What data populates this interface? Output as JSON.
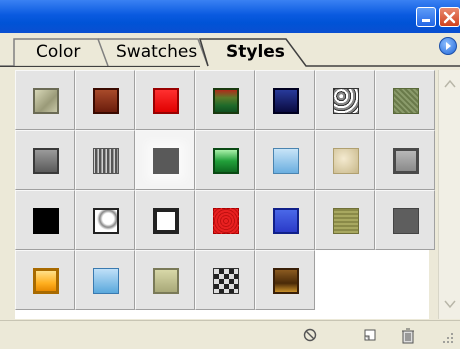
{
  "tabs": [
    {
      "label": "Color"
    },
    {
      "label": "Swatches"
    },
    {
      "label": "Styles"
    }
  ],
  "colors": {
    "titlebar": "#0a5ae0",
    "panel_bg": "#ece9d8",
    "cell_bg": "#e4e4e4"
  },
  "styles": [
    {
      "name": "style-marble-beige",
      "bg": "linear-gradient(135deg,#d8d8b8,#9a9a78 60%,#c8c8a8)",
      "border": "2px solid #6b6b55"
    },
    {
      "name": "style-rust-brown",
      "bg": "linear-gradient(#a84a2a,#6a1c0c)",
      "border": "2px solid #3a0a00"
    },
    {
      "name": "style-red",
      "bg": "linear-gradient(#ff3030,#e00000)",
      "border": "2px solid #900"
    },
    {
      "name": "style-green-red",
      "bg": "linear-gradient(#b02a1a 0%,#5a7a2a 35%,#1f6a2a 70%,#105020)",
      "border": "2px solid #1a3a10"
    },
    {
      "name": "style-navy",
      "bg": "linear-gradient(#283a9a,#0a0a40)",
      "border": "2px solid #000020"
    },
    {
      "name": "style-marble-gray",
      "bg": "repeating-radial-gradient(circle at 30% 30%,#fff 0 2px,#888 2px 4px,#333 4px 5px)",
      "border": "1px solid #333"
    },
    {
      "name": "style-olive-textured",
      "bg": "repeating-linear-gradient(45deg,#6a7a4a 0 2px,#8a9a6a 2px 4px)",
      "border": "1px solid #5a6a3a"
    },
    {
      "name": "style-gray-bevel",
      "bg": "linear-gradient(#9a9a9a,#5a5a5a)",
      "border": "2px solid #3a3a3a"
    },
    {
      "name": "style-woodgrain-gray",
      "bg": "repeating-linear-gradient(90deg,#d0d0d0 0 1px,#555 1px 3px,#999 3px 4px)",
      "border": "1px solid #555"
    },
    {
      "name": "style-dark-gray-glow",
      "bg": "#595959",
      "border": "none"
    },
    {
      "name": "style-green-bevel",
      "bg": "linear-gradient(#a8f0a8,#22a03a 50%,#0e6a20)",
      "border": "2px solid #0a4a14"
    },
    {
      "name": "style-light-blue",
      "bg": "linear-gradient(#c8e4f8,#6aaee0)",
      "border": "1px solid #4a84b0"
    },
    {
      "name": "style-parchment",
      "bg": "radial-gradient(circle at 40% 40%,#f4ead0,#c8b88a)",
      "border": "1px solid #b0a070"
    },
    {
      "name": "style-silver-frame",
      "bg": "linear-gradient(#b8b8b8,#8a8a8a)",
      "border": "3px solid #4a4a4a"
    },
    {
      "name": "style-black",
      "bg": "#000000",
      "border": "2px solid #000"
    },
    {
      "name": "style-splatter-white",
      "bg": "radial-gradient(circle at 60% 40%,#fff 30%,#888 45%,#fff 60%)",
      "border": "2px solid #222"
    },
    {
      "name": "style-white-framed",
      "bg": "#ffffff",
      "border": "4px solid #222"
    },
    {
      "name": "style-red-rough",
      "bg": "repeating-radial-gradient(circle,#e82020 0 2px,#c01010 2px 3px)",
      "border": "1px dashed #a00"
    },
    {
      "name": "style-blue",
      "bg": "linear-gradient(#4a68e8,#2a3ac8)",
      "border": "2px solid #10208a"
    },
    {
      "name": "style-olive-woven",
      "bg": "repeating-linear-gradient(0deg,#a8a860 0 2px,#8a8a48 2px 4px)",
      "border": "1px solid #707038"
    },
    {
      "name": "style-gray-flat",
      "bg": "#5e5e5e",
      "border": "1px solid #444"
    },
    {
      "name": "style-orange-gold",
      "bg": "linear-gradient(#ffe08a,#ffb020 60%,#e88a00)",
      "border": "3px solid #a86a00"
    },
    {
      "name": "style-sky-blue",
      "bg": "linear-gradient(#c0e0f8,#5aa8dc)",
      "border": "1px solid #3a7ab0"
    },
    {
      "name": "style-khaki",
      "bg": "linear-gradient(#d8d8a8,#a8a878)",
      "border": "2px solid #7a7a58"
    },
    {
      "name": "style-checker",
      "bg": "conic-gradient(#222 25%,#ddd 0 50%,#222 0 75%,#ddd 0) 0 0/10px 10px",
      "border": "1px solid #333"
    },
    {
      "name": "style-bronze",
      "bg": "linear-gradient(#8a5a20,#4a2a08 60%,#c8902a)",
      "border": "2px solid #3a2008"
    }
  ]
}
